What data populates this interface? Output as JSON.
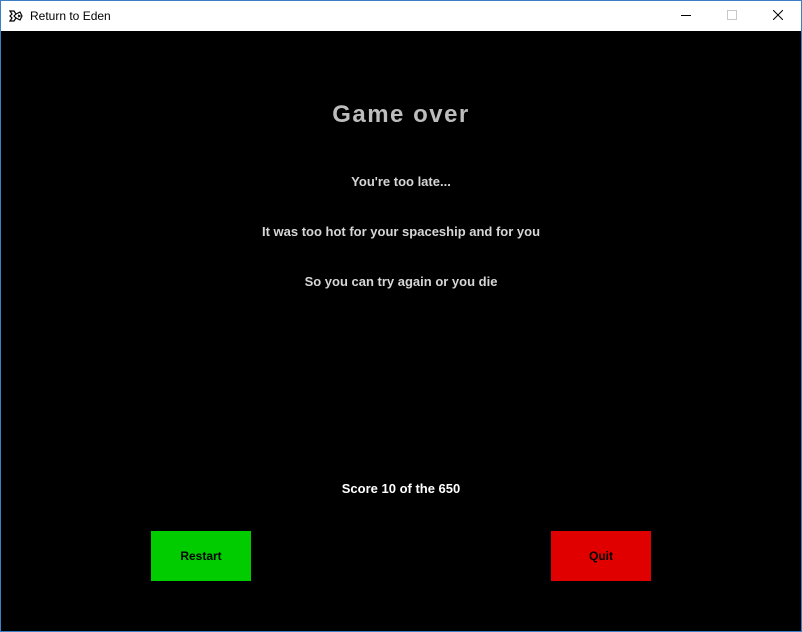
{
  "window": {
    "title": "Return to Eden",
    "icons": {
      "app": "app-icon",
      "minimize": "minimize-icon",
      "maximize": "maximize-icon",
      "close": "close-icon"
    }
  },
  "game_over": {
    "heading": "Game over",
    "messages": [
      "You're too late...",
      "It was too hot for your spaceship and for you",
      "So you can try again or you die"
    ],
    "score_text": "Score 10 of the 650"
  },
  "buttons": {
    "restart_label": "Restart",
    "quit_label": "Quit"
  },
  "colors": {
    "background": "#000000",
    "heading": "#bdbdbd",
    "restart": "#00cc00",
    "quit": "#e00000"
  }
}
